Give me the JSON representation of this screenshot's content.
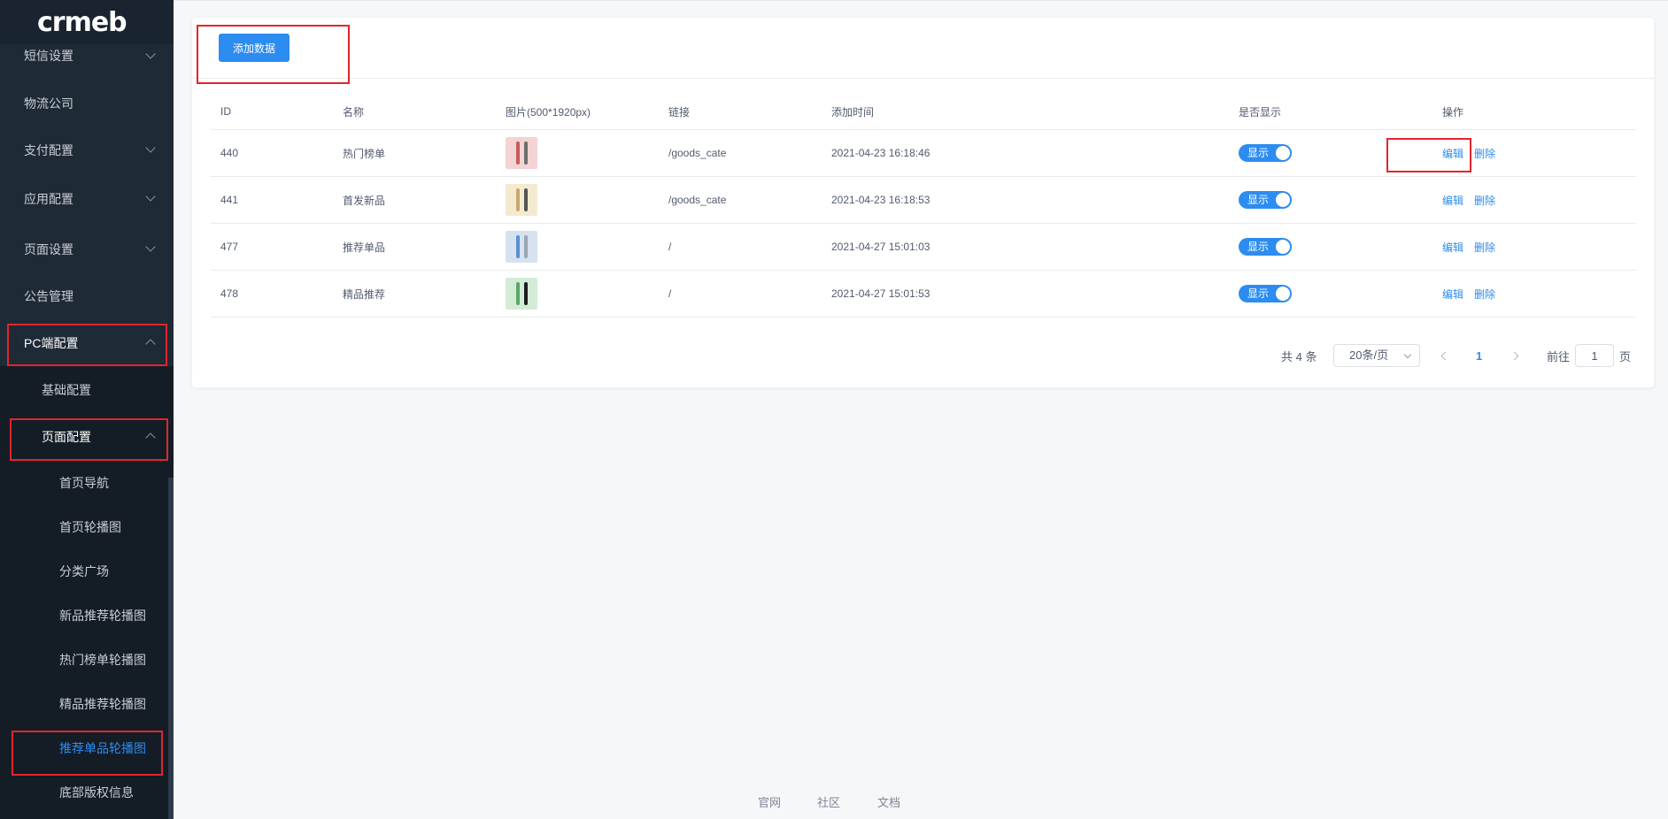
{
  "logo": {
    "text": "crmeb"
  },
  "sidebar": {
    "items": [
      {
        "label": "短信设置"
      },
      {
        "label": "物流公司"
      },
      {
        "label": "支付配置"
      },
      {
        "label": "应用配置"
      },
      {
        "label": "页面设置"
      },
      {
        "label": "公告管理"
      },
      {
        "label": "PC端配置"
      },
      {
        "label": "基础配置"
      },
      {
        "label": "页面配置"
      },
      {
        "label": "首页导航"
      },
      {
        "label": "首页轮播图"
      },
      {
        "label": "分类广场"
      },
      {
        "label": "新品推荐轮播图"
      },
      {
        "label": "热门榜单轮播图"
      },
      {
        "label": "精品推荐轮播图"
      },
      {
        "label": "推荐单品轮播图"
      },
      {
        "label": "底部版权信息"
      }
    ]
  },
  "toolbar": {
    "add_label": "添加数据"
  },
  "table": {
    "headers": [
      "ID",
      "名称",
      "图片(500*1920px)",
      "链接",
      "添加时间",
      "是否显示",
      "操作"
    ],
    "rows": [
      {
        "id": "440",
        "name": "热门榜单",
        "link": "/goods_cate",
        "time": "2021-04-23 16:18:46",
        "status": "显示",
        "edit": "编辑",
        "del": "删除",
        "thumb_bg": "#f3d3d3",
        "thumb_a": "#c85a5a",
        "thumb_b": "#6d6d6d"
      },
      {
        "id": "441",
        "name": "首发新品",
        "link": "/goods_cate",
        "time": "2021-04-23 16:18:53",
        "status": "显示",
        "edit": "编辑",
        "del": "删除",
        "thumb_bg": "#f3ead0",
        "thumb_a": "#c9a96a",
        "thumb_b": "#555555"
      },
      {
        "id": "477",
        "name": "推荐单品",
        "link": "/",
        "time": "2021-04-27 15:01:03",
        "status": "显示",
        "edit": "编辑",
        "del": "删除",
        "thumb_bg": "#d7e2f0",
        "thumb_a": "#5b8fd6",
        "thumb_b": "#9aa6b3"
      },
      {
        "id": "478",
        "name": "精品推荐",
        "link": "/",
        "time": "2021-04-27 15:01:53",
        "status": "显示",
        "edit": "编辑",
        "del": "删除",
        "thumb_bg": "#d3ecd5",
        "thumb_a": "#5aa86a",
        "thumb_b": "#1e1e1e"
      }
    ]
  },
  "pagination": {
    "total": "共 4 条",
    "page_size": "20条/页",
    "current": "1",
    "goto_prefix": "前往",
    "goto_value": "1",
    "goto_suffix": "页"
  },
  "footer": {
    "links": [
      "官网",
      "社区",
      "文档"
    ]
  },
  "colors": {
    "primary": "#2d8cf0",
    "sidebar_bg": "#1f2a37",
    "highlight_border": "#e0262b"
  }
}
